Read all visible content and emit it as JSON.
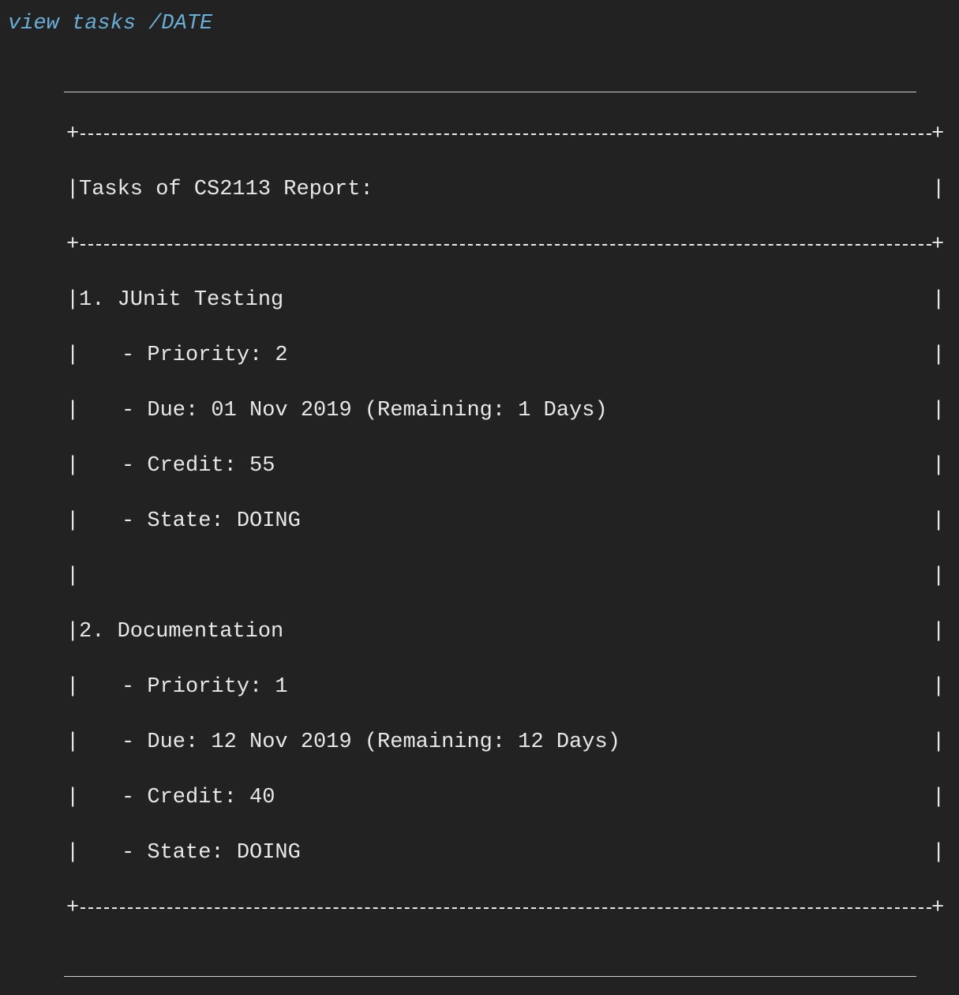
{
  "command": "view tasks /DATE",
  "table": {
    "border_corner": "+",
    "bar": "|",
    "header": "Tasks of CS2113 Report:",
    "tasks": [
      {
        "title": "1. JUnit Testing",
        "priority": "- Priority: 2",
        "due": "- Due: 01 Nov 2019 (Remaining: 1 Days)",
        "credit": "- Credit: 55",
        "state": "- State: DOING"
      },
      {
        "title": "2. Documentation",
        "priority": "- Priority: 1",
        "due": "- Due: 12 Nov 2019 (Remaining: 12 Days)",
        "credit": "- Credit: 40",
        "state": "- State: DOING"
      }
    ]
  },
  "colors": {
    "background": "#222222",
    "command_text": "#6aaed6",
    "output_text": "#e8e8e8",
    "rule": "#cfcfcf"
  }
}
